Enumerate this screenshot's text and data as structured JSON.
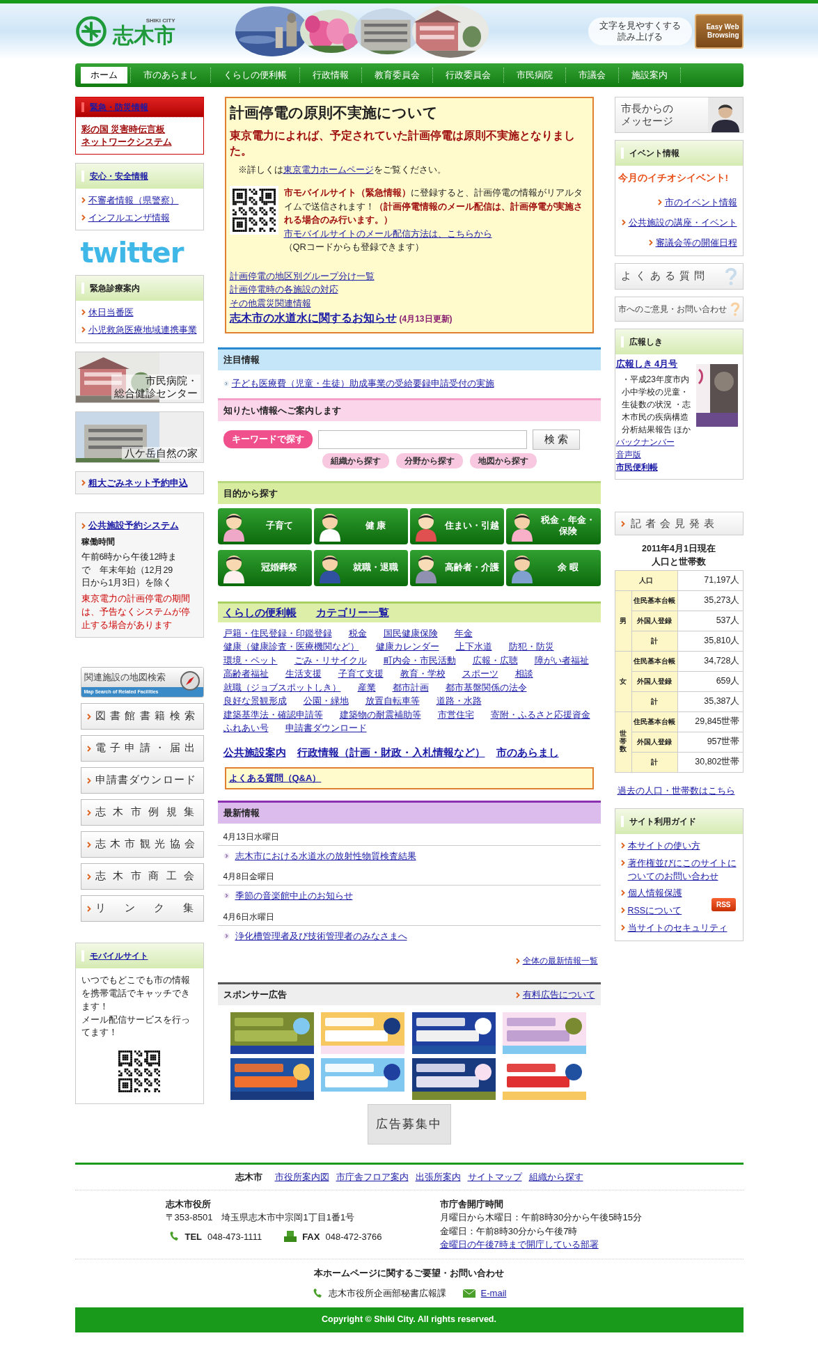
{
  "header": {
    "logo_sub": "SHIKI CITY",
    "logo": "志木市",
    "photos": [
      {
        "kind": "picture"
      },
      {
        "kind": "picture"
      },
      {
        "kind": "picture"
      },
      {
        "kind": "picture"
      }
    ],
    "accessibility": [
      "文字を見やすくする",
      "読み上げる"
    ],
    "easy_web": "Easy Web Browsing"
  },
  "nav": [
    {
      "label": "ホーム",
      "selected": true
    },
    {
      "label": "市のあらまし",
      "selected": false
    },
    {
      "label": "くらしの便利帳",
      "selected": false
    },
    {
      "label": "行政情報",
      "selected": false
    },
    {
      "label": "教育委員会",
      "selected": false
    },
    {
      "label": "行政委員会",
      "selected": false
    },
    {
      "label": "市民病院",
      "selected": false
    },
    {
      "label": "市議会",
      "selected": false
    },
    {
      "label": "施設案内",
      "selected": false
    }
  ],
  "left": {
    "emergency": {
      "title": "緊急・防災情報",
      "link_lines": [
        "彩の国 災害時伝言板",
        "ネットワークシステム"
      ]
    },
    "safety": {
      "title": "安心・安全情報",
      "links": [
        "不審者情報（県警察）",
        "インフルエンザ情報"
      ]
    },
    "twitter": "twitter",
    "clinic": {
      "title": "緊急診療案内",
      "links": [
        "休日当番医",
        "小児救急医療地域連携事業"
      ]
    },
    "banners": [
      {
        "label_lines": [
          "市民病院・",
          "総合健診センター"
        ]
      },
      {
        "label_lines": [
          "八ケ岳自然の家"
        ]
      }
    ],
    "garbage": "粗大ごみネット予約申込",
    "facility": {
      "title": "公共施設予約システム",
      "subtitle": "稼働時間",
      "body": "午前6時から午後12時まで　年末年始（12月29日から1月3日）を除く",
      "warning": "東京電力の計画停電の期間は、予告なくシステムが停止する場合があります"
    },
    "map_search": {
      "title": "関連施設の地図検索",
      "subtitle": "Map Search of Related Facilities"
    },
    "quick_links": [
      "図書館書籍検索",
      "電子申請・届出",
      "申請書ダウンロード",
      "志木市例規集",
      "志木市観光協会",
      "志木市商工会",
      "リンク集"
    ],
    "mobile": {
      "title": "モバイルサイト",
      "body": "いつでもどこでも市の情報を携帯電話でキャッチできます！",
      "body2": "メール配信サービスを行ってます！"
    }
  },
  "notice": {
    "title": "計画停電の原則不実施について",
    "headline": "東京電力によれば、予定されていた計画停電は原則不実施となりました。",
    "detail": [
      {
        "kind": "plain",
        "text": "※詳しくは"
      },
      {
        "kind": "link",
        "text": "東京電力ホームページ"
      },
      {
        "kind": "plain",
        "text": "をご覧ください。"
      }
    ],
    "mobile": [
      {
        "kind": "alert",
        "text": "市モバイルサイト（緊急情報）"
      },
      {
        "kind": "plain",
        "text": "に登録すると、計画停電の情報がリアルタイムで送信されます！"
      },
      {
        "kind": "alert",
        "text": "（計画停電情報のメール配信は、計画停電が実施される場合のみ行います。）"
      }
    ],
    "mobile_link": "市モバイルサイトのメール配信方法は、こちらから",
    "qr_note": "（QRコードからも登録できます）",
    "links": [
      "計画停電の地区別グループ分け一覧",
      "計画停電時の各施設の対応",
      "その他震災関連情報"
    ],
    "water": {
      "link": "志木市の水道水に関するお知らせ",
      "note": "(4月13日更新)"
    }
  },
  "featured": {
    "title": "注目情報",
    "link": "子ども医療費（児童・生徒）助成事業の受給要録申請受付の実施"
  },
  "guide": {
    "title": "知りたい情報へご案内します",
    "keyword_label": "キーワードで探す",
    "search_button": "検 索",
    "options": [
      "組織から探す",
      "分野から探す",
      "地図から探す"
    ]
  },
  "purpose": {
    "title": "目的から探す",
    "buttons": [
      "子育て",
      "健 康",
      "住まい・引越",
      "税金・年金・保険",
      "冠婚葬祭",
      "就職・退職",
      "高齢者・介護",
      "余 暇"
    ]
  },
  "kurashi": {
    "title": "くらしの便利帳",
    "category": "カテゴリー一覧",
    "links": [
      "戸籍・住民登録・印鑑登録",
      "税金",
      "国民健康保険",
      "年金",
      "健康（健康診査・医療機関など）",
      "健康カレンダー",
      "上下水道",
      "防犯・防災",
      "環境・ペット",
      "ごみ・リサイクル",
      "町内会・市民活動",
      "広報・広聴",
      "障がい者福祉",
      "高齢者福祉",
      "生活支援",
      "子育て支援",
      "教育・学校",
      "スポーツ",
      "相談",
      "就職（ジョブスポットしき）",
      "産業",
      "都市計画",
      "都市基盤関係の法令",
      "良好な景観形成",
      "公園・緑地",
      "放置自転車等",
      "道路・水路",
      "建築基準法・確認申請等",
      "建築物の耐震補助等",
      "市営住宅",
      "寄附・ふるさと応援資金",
      "ふれあい号",
      "申請書ダウンロード"
    ],
    "big_links": [
      "公共施設案内",
      "行政情報（計画・財政・入札情報など）",
      "市のあらまし"
    ],
    "faq": "よくある質問（Q&A）"
  },
  "news": {
    "title": "最新情報",
    "groups": [
      {
        "date": "4月13日水曜日",
        "link": "志木市における水道水の放射性物質検査結果"
      },
      {
        "date": "4月8日金曜日",
        "link": "季節の音楽館中止のお知らせ"
      },
      {
        "date": "4月6日水曜日",
        "link": "浄化槽管理者及び技術管理者のみなさまへ"
      }
    ],
    "more": "全体の最新情報一覧"
  },
  "sponsor": {
    "title": "スポンサー広告",
    "link": "有料広告について",
    "ads": [
      {
        "kind": "picture"
      },
      {
        "kind": "picture"
      },
      {
        "kind": "picture"
      },
      {
        "kind": "picture"
      },
      {
        "kind": "picture"
      },
      {
        "kind": "picture"
      },
      {
        "kind": "picture"
      },
      {
        "kind": "picture"
      }
    ],
    "recruiting": "広告募集中"
  },
  "right": {
    "mayor_lines": [
      "市長からの",
      "メッセージ"
    ],
    "events": {
      "title": "イベント情報",
      "headline": "今月のイチオシイベント!",
      "links": [
        "市のイベント情報",
        "公共施設の講座・イベント",
        "審議会等の開催日程"
      ]
    },
    "faq": "よくある質問",
    "contact": "市へのご意見・お問い合わせ",
    "kouhou": {
      "title": "広報しき",
      "link": "広報しき 4月号",
      "body": "・平成23年度市内小中学校の児童・生徒数の状況 ・志木市民の疾病構造分析結果報告 ほか",
      "links": [
        "バックナンバー",
        "音声版",
        "市民便利帳"
      ]
    },
    "press": "記者会見発表",
    "population": {
      "title": "2011年4月1日現在",
      "subtitle": "人口と世帯数",
      "total": {
        "label": "人口",
        "value": "71,197人"
      },
      "groups": [
        {
          "label": "男",
          "rows": [
            {
              "label": "住民基本台帳",
              "value": "35,273人"
            },
            {
              "label": "外国人登録",
              "value": "537人"
            },
            {
              "label": "計",
              "value": "35,810人"
            }
          ]
        },
        {
          "label": "女",
          "rows": [
            {
              "label": "住民基本台帳",
              "value": "34,728人"
            },
            {
              "label": "外国人登録",
              "value": "659人"
            },
            {
              "label": "計",
              "value": "35,387人"
            }
          ]
        },
        {
          "label": "世帯数",
          "rows": [
            {
              "label": "住民基本台帳",
              "value": "29,845世帯"
            },
            {
              "label": "外国人登録",
              "value": "957世帯"
            },
            {
              "label": "計",
              "value": "30,802世帯"
            }
          ]
        }
      ],
      "link": "過去の人口・世帯数はこちら"
    },
    "site_guide": {
      "title": "サイト利用ガイド",
      "links": [
        "本サイトの使い方",
        "著作権並びにこのサイトについてのお問い合わせ",
        "個人情報保護",
        "RSSについて",
        "当サイトのセキュリティ"
      ],
      "rss": "RSS"
    }
  },
  "footer": {
    "city": "志木市",
    "links": [
      "市役所案内図",
      "市庁舎フロア案内",
      "出張所案内",
      "サイトマップ",
      "組織から探す"
    ],
    "office": {
      "name": "志木市役所",
      "address": "〒353-8501　埼玉県志木市中宗岡1丁目1番1号",
      "tel_label": "TEL",
      "tel": "048-473-1111",
      "fax_label": "FAX",
      "fax": "048-472-3766"
    },
    "hours": {
      "title": "市庁舎開庁時間",
      "lines": [
        "月曜日から木曜日：午前8時30分から午後5時15分",
        "金曜日：午前8時30分から午後7時"
      ],
      "link": "金曜日の午後7時まで開庁している部署"
    },
    "contact_title": "本ホームページに関するご要望・お問い合わせ",
    "department": "志木市役所企画部秘書広報課",
    "email": "E-mail",
    "copyright": "Copyright © Shiki City. All rights reserved."
  }
}
